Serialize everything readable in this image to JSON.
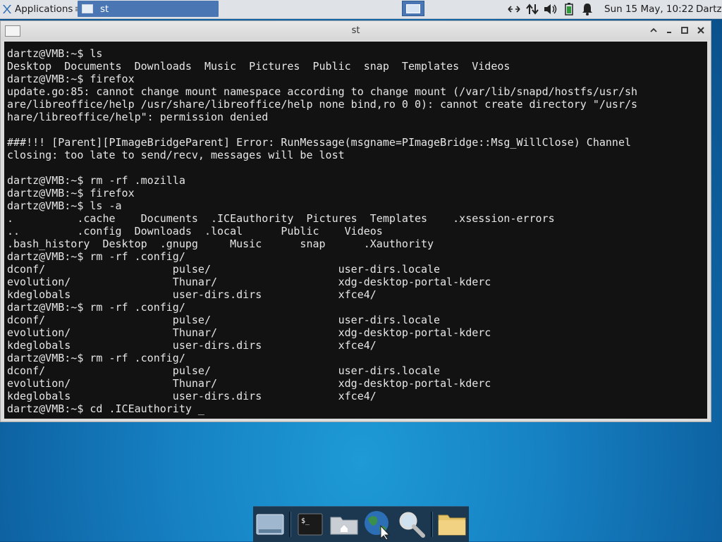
{
  "top_panel": {
    "apps_label": "Applications",
    "window_tab_title": "st",
    "clock": "Sun 15 May, 10:22",
    "user": "Dartz"
  },
  "window": {
    "title": "st"
  },
  "terminal": {
    "lines": [
      "dartz@VMB:~$ ls",
      "Desktop  Documents  Downloads  Music  Pictures  Public  snap  Templates  Videos",
      "dartz@VMB:~$ firefox",
      "update.go:85: cannot change mount namespace according to change mount (/var/lib/snapd/hostfs/usr/sh",
      "are/libreoffice/help /usr/share/libreoffice/help none bind,ro 0 0): cannot create directory \"/usr/s",
      "hare/libreoffice/help\": permission denied",
      "",
      "###!!! [Parent][PImageBridgeParent] Error: RunMessage(msgname=PImageBridge::Msg_WillClose) Channel",
      "closing: too late to send/recv, messages will be lost",
      "",
      "dartz@VMB:~$ rm -rf .mozilla",
      "dartz@VMB:~$ firefox",
      "dartz@VMB:~$ ls -a",
      ".          .cache    Documents  .ICEauthority  Pictures  Templates    .xsession-errors",
      "..         .config  Downloads  .local      Public    Videos",
      ".bash_history  Desktop  .gnupg     Music      snap      .Xauthority",
      "dartz@VMB:~$ rm -rf .config/",
      "dconf/                    pulse/                    user-dirs.locale",
      "evolution/                Thunar/                   xdg-desktop-portal-kderc",
      "kdeglobals                user-dirs.dirs            xfce4/",
      "dartz@VMB:~$ rm -rf .config/",
      "dconf/                    pulse/                    user-dirs.locale",
      "evolution/                Thunar/                   xdg-desktop-portal-kderc",
      "kdeglobals                user-dirs.dirs            xfce4/",
      "dartz@VMB:~$ rm -rf .config/",
      "dconf/                    pulse/                    user-dirs.locale",
      "evolution/                Thunar/                   xdg-desktop-portal-kderc",
      "kdeglobals                user-dirs.dirs            xfce4/",
      "dartz@VMB:~$ cd .ICEauthority _"
    ]
  },
  "tray_icons": [
    "network-arrows-icon",
    "network-updown-icon",
    "volume-icon",
    "battery-icon",
    "notification-bell-icon"
  ],
  "dock_items": [
    "show-desktop-icon",
    "terminal-icon",
    "home-folder-icon",
    "web-browser-icon",
    "search-icon",
    "files-folder-icon"
  ]
}
